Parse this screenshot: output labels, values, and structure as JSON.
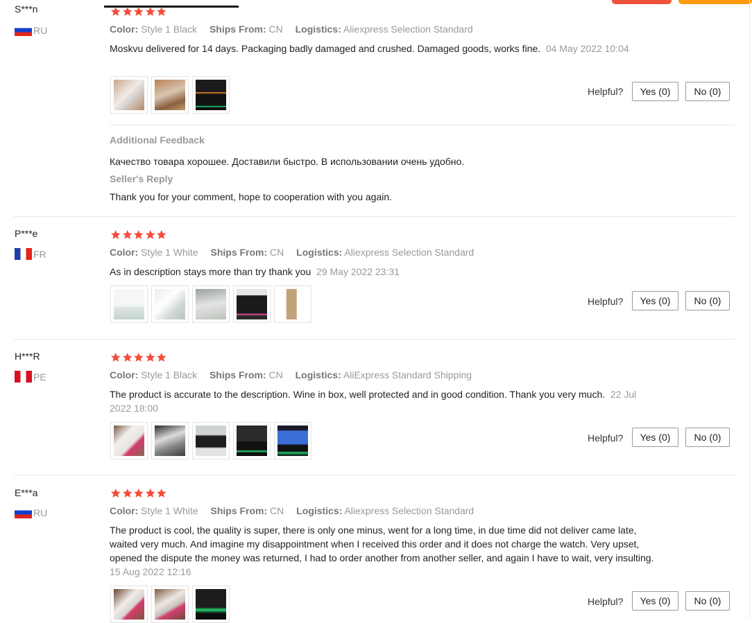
{
  "reviews": [
    {
      "user": "S***n",
      "country": "RU",
      "rating": 5,
      "color_label": "Color:",
      "color": "Style 1 Black",
      "ships_label": "Ships From:",
      "ships": "CN",
      "logistics_label": "Logistics:",
      "logistics": "Aliexpress Selection Standard",
      "text": "Moskvu delivered for 14 days. Packaging badly damaged and crushed. Damaged goods, works fine.",
      "date": "04 May 2022 10:04",
      "helpful_label": "Helpful?",
      "yes_label": "Yes (0)",
      "no_label": "No (0)",
      "additional_feedback_label": "Additional Feedback",
      "additional_feedback": "Качество товара хорошее. Доставили быстро. В использовании очень удобно.",
      "seller_reply_label": "Seller's Reply",
      "seller_reply": "Thank you for your comment, hope to cooperation with you again."
    },
    {
      "user": "P***e",
      "country": "FR",
      "rating": 5,
      "color_label": "Color:",
      "color": "Style 1 White",
      "ships_label": "Ships From:",
      "ships": "CN",
      "logistics_label": "Logistics:",
      "logistics": "Aliexpress Selection Standard",
      "text": "As in description stays more than try thank you",
      "date": "29 May 2022 23:31",
      "helpful_label": "Helpful?",
      "yes_label": "Yes (0)",
      "no_label": "No (0)"
    },
    {
      "user": "H***R",
      "country": "PE",
      "rating": 5,
      "color_label": "Color:",
      "color": "Style 1 Black",
      "ships_label": "Ships From:",
      "ships": "CN",
      "logistics_label": "Logistics:",
      "logistics": "AliExpress Standard Shipping",
      "text": "The product is accurate to the description. Wine in box, well protected and in good condition. Thank you very much.",
      "date": "22 Jul 2022 18:00",
      "helpful_label": "Helpful?",
      "yes_label": "Yes (0)",
      "no_label": "No (0)"
    },
    {
      "user": "E***a",
      "country": "RU",
      "rating": 5,
      "color_label": "Color:",
      "color": "Style 1 White",
      "ships_label": "Ships From:",
      "ships": "CN",
      "logistics_label": "Logistics:",
      "logistics": "Aliexpress Selection Standard",
      "text": "The product is cool, the quality is super, there is only one minus, went for a long time, in due time did not deliver came late, waited very much. And imagine my disappointment when I received this order and it does not charge the watch. Very upset, opened the dispute the money was returned, I had to order another from another seller, and again I have to wait, very insulting.",
      "date": "15 Aug 2022 12:16",
      "helpful_label": "Helpful?",
      "yes_label": "Yes (0)",
      "no_label": "No (0)"
    }
  ],
  "colors": {
    "star": "#f44c3a",
    "accent_red": "#f0513a",
    "accent_orange": "#ff9a0f"
  }
}
